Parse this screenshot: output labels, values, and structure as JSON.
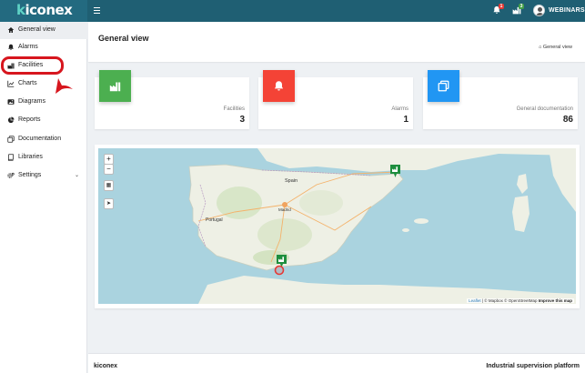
{
  "app": {
    "logo": "kiconex",
    "user": "WEBINARS",
    "alarm_badge": "1",
    "doc_badge": "3"
  },
  "sidebar": {
    "items": [
      {
        "label": "General view",
        "icon": "home-icon",
        "active": true
      },
      {
        "label": "Alarms",
        "icon": "bell-icon"
      },
      {
        "label": "Facilities",
        "icon": "factory-icon"
      },
      {
        "label": "Charts",
        "icon": "line-chart-icon"
      },
      {
        "label": "Diagrams",
        "icon": "image-icon"
      },
      {
        "label": "Reports",
        "icon": "pie-chart-icon"
      },
      {
        "label": "Documentation",
        "icon": "copy-icon"
      },
      {
        "label": "Libraries",
        "icon": "book-icon"
      },
      {
        "label": "Settings",
        "icon": "gear-icon",
        "chevron": "chevron-down-icon"
      }
    ]
  },
  "header": {
    "title": "General view",
    "breadcrumb": "General view"
  },
  "cards": [
    {
      "caption": "Facilities",
      "value": "3",
      "color": "#4caf50",
      "icon": "factory-icon"
    },
    {
      "caption": "Alarms",
      "value": "1",
      "color": "#f44336",
      "icon": "bell-icon"
    },
    {
      "caption": "General documentation",
      "value": "86",
      "color": "#2196f3",
      "icon": "copy-icon"
    }
  ],
  "map": {
    "labels": {
      "spain": "Spain",
      "portugal": "Portugal",
      "madrid": "Madrid"
    },
    "attribution": {
      "leaflet": "Leaflet",
      "mapbox": "© Mapbox",
      "osm": "© OpenStreetMap",
      "improve": "Improve this map"
    }
  },
  "footer": {
    "brand": "kiconex",
    "tagline": "Industrial supervision platform"
  },
  "colors": {
    "topbar": "#1f5f73",
    "highlight": "#d7161e",
    "marker": "#1e8e3e",
    "sea": "#aad3df",
    "land": "#eef0e5"
  }
}
